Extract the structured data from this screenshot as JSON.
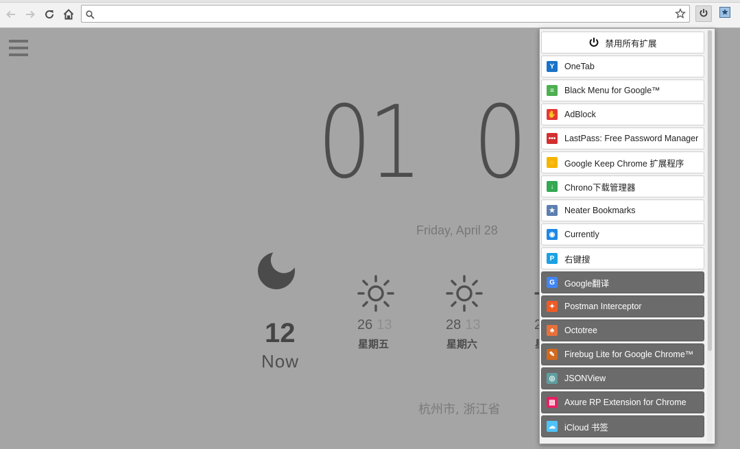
{
  "browser": {
    "omnibox_value": "",
    "icons": [
      "back-icon",
      "forward-icon",
      "reload-icon",
      "home-icon",
      "search-icon",
      "star-icon",
      "power-icon",
      "neater-bookmarks-icon"
    ]
  },
  "newtab": {
    "clock_hours": "01",
    "clock_minutes_partial": "0",
    "date": "Friday, April 28",
    "now": {
      "temp": "12",
      "label": "Now",
      "icon": "moon-icon"
    },
    "forecast": [
      {
        "hi": "26",
        "lo": "13",
        "day": "星期五",
        "icon": "sun-icon"
      },
      {
        "hi": "28",
        "lo": "13",
        "day": "星期六",
        "icon": "sun-icon"
      },
      {
        "hi": "2",
        "lo": "",
        "day": "星",
        "icon": "sun-icon"
      }
    ],
    "location": "杭州市, 浙江省"
  },
  "extensions_popup": {
    "disable_all_label": "禁用所有扩展",
    "items": [
      {
        "label": "OneTab",
        "enabled": true,
        "icon": "onetab-icon",
        "color": "#1a73c8"
      },
      {
        "label": "Black Menu for Google™",
        "enabled": true,
        "icon": "black-menu-icon",
        "color": "#4caf50"
      },
      {
        "label": "AdBlock",
        "enabled": true,
        "icon": "adblock-icon",
        "color": "#e53935"
      },
      {
        "label": "LastPass: Free Password Manager",
        "enabled": true,
        "icon": "lastpass-icon",
        "color": "#d32f2f"
      },
      {
        "label": "Google Keep Chrome 扩展程序",
        "enabled": true,
        "icon": "keep-icon",
        "color": "#f6b400"
      },
      {
        "label": "Chrono下载管理器",
        "enabled": true,
        "icon": "chrono-icon",
        "color": "#34a853"
      },
      {
        "label": "Neater Bookmarks",
        "enabled": true,
        "icon": "neater-icon",
        "color": "#5b7fb0"
      },
      {
        "label": "Currently",
        "enabled": true,
        "icon": "currently-icon",
        "color": "#1e88e5"
      },
      {
        "label": "右键搜",
        "enabled": true,
        "icon": "youjiansou-icon",
        "color": "#1ba1e2"
      },
      {
        "label": "Google翻译",
        "enabled": false,
        "icon": "google-translate-icon",
        "color": "#4285f4"
      },
      {
        "label": "Postman Interceptor",
        "enabled": false,
        "icon": "postman-icon",
        "color": "#ef5b25"
      },
      {
        "label": "Octotree",
        "enabled": false,
        "icon": "octotree-icon",
        "color": "#e8703a"
      },
      {
        "label": "Firebug Lite for Google Chrome™",
        "enabled": false,
        "icon": "firebug-icon",
        "color": "#d2691e"
      },
      {
        "label": "JSONView",
        "enabled": false,
        "icon": "jsonview-icon",
        "color": "#5f9ea0"
      },
      {
        "label": "Axure RP Extension for Chrome",
        "enabled": false,
        "icon": "axure-icon",
        "color": "#e91e63"
      },
      {
        "label": "iCloud 书签",
        "enabled": false,
        "icon": "icloud-icon",
        "color": "#4fc3f7"
      }
    ]
  }
}
